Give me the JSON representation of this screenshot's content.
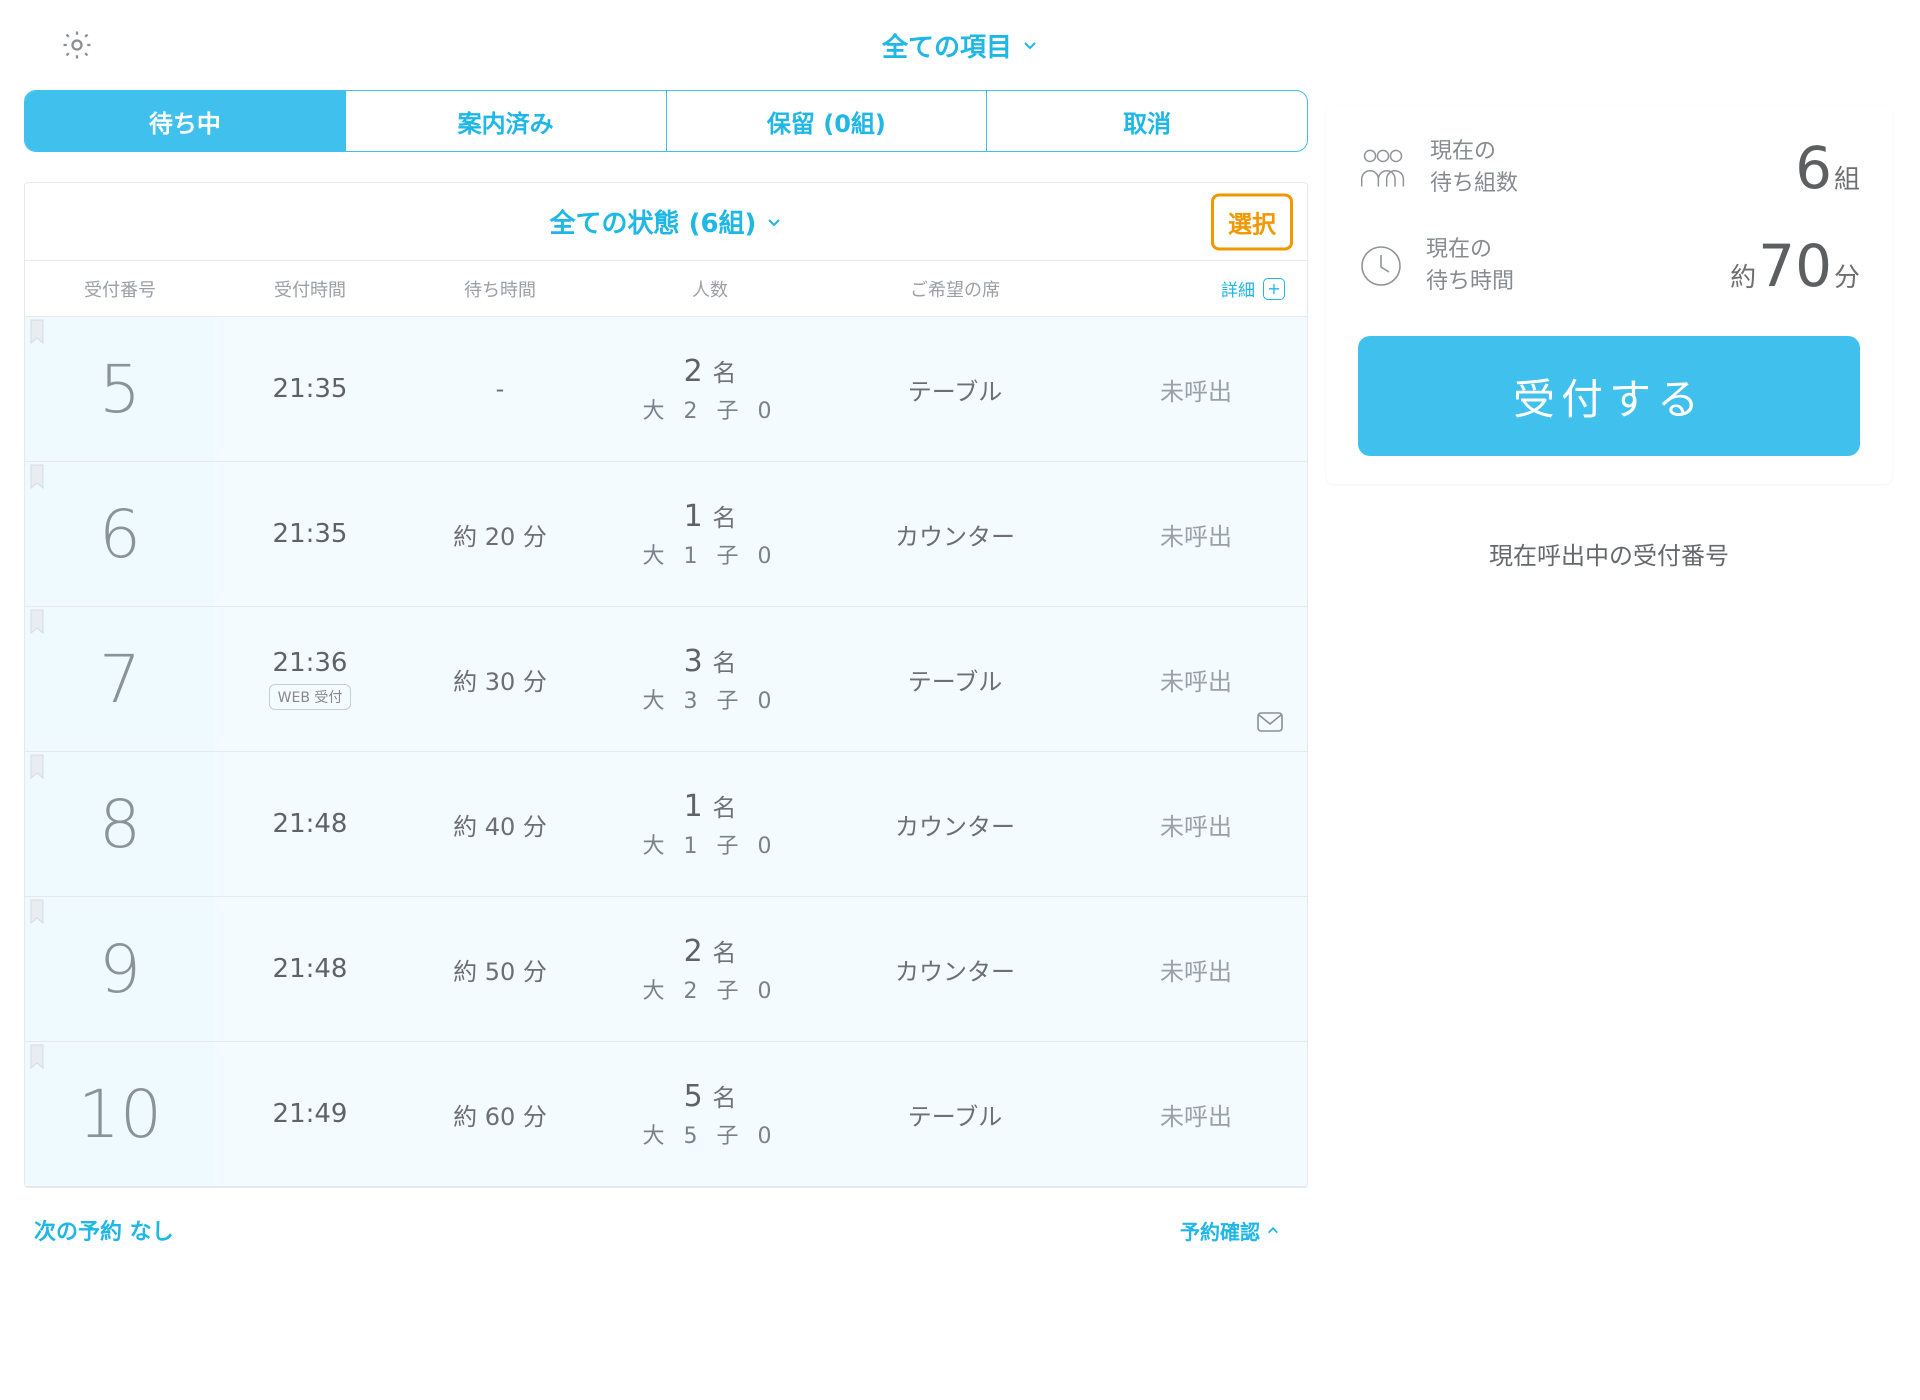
{
  "top": {
    "filter_label": "全ての項目"
  },
  "tabs": {
    "waiting": "待ち中",
    "seated": "案内済み",
    "hold": "保留 (0組)",
    "cancel": "取消",
    "active": "waiting"
  },
  "panel": {
    "status_label": "全ての状態 (6組)",
    "select_label": "選択"
  },
  "cols": {
    "num": "受付番号",
    "recv": "受付時間",
    "wait": "待ち時間",
    "party": "人数",
    "seat": "ご希望の席",
    "detail": "詳細"
  },
  "rows": [
    {
      "num": "5",
      "time": "21:35",
      "wait": "-",
      "party_top_n": "2",
      "party_top_suf": "名",
      "party_sub": "大 2 子 0",
      "seat": "テーブル",
      "status": "未呼出",
      "tag": "",
      "mail": false
    },
    {
      "num": "6",
      "time": "21:35",
      "wait": "約 20 分",
      "party_top_n": "1",
      "party_top_suf": "名",
      "party_sub": "大 1 子 0",
      "seat": "カウンター",
      "status": "未呼出",
      "tag": "",
      "mail": false
    },
    {
      "num": "7",
      "time": "21:36",
      "wait": "約 30 分",
      "party_top_n": "3",
      "party_top_suf": "名",
      "party_sub": "大 3 子 0",
      "seat": "テーブル",
      "status": "未呼出",
      "tag": "WEB 受付",
      "mail": true
    },
    {
      "num": "8",
      "time": "21:48",
      "wait": "約 40 分",
      "party_top_n": "1",
      "party_top_suf": "名",
      "party_sub": "大 1 子 0",
      "seat": "カウンター",
      "status": "未呼出",
      "tag": "",
      "mail": false
    },
    {
      "num": "9",
      "time": "21:48",
      "wait": "約 50 分",
      "party_top_n": "2",
      "party_top_suf": "名",
      "party_sub": "大 2 子 0",
      "seat": "カウンター",
      "status": "未呼出",
      "tag": "",
      "mail": false
    },
    {
      "num": "10",
      "time": "21:49",
      "wait": "約 60 分",
      "party_top_n": "5",
      "party_top_suf": "名",
      "party_sub": "大 5 子 0",
      "seat": "テーブル",
      "status": "未呼出",
      "tag": "",
      "mail": false
    }
  ],
  "footer": {
    "next_res": "次の予約 なし",
    "res_confirm": "予約確認"
  },
  "side": {
    "groups_l1": "現在の",
    "groups_l2": "待ち組数",
    "groups_n": "6",
    "groups_suf": "組",
    "wait_l1": "現在の",
    "wait_l2": "待ち時間",
    "wait_pre": "約",
    "wait_n": "70",
    "wait_suf": "分",
    "register": "受付する",
    "calling_title": "現在呼出中の受付番号"
  }
}
